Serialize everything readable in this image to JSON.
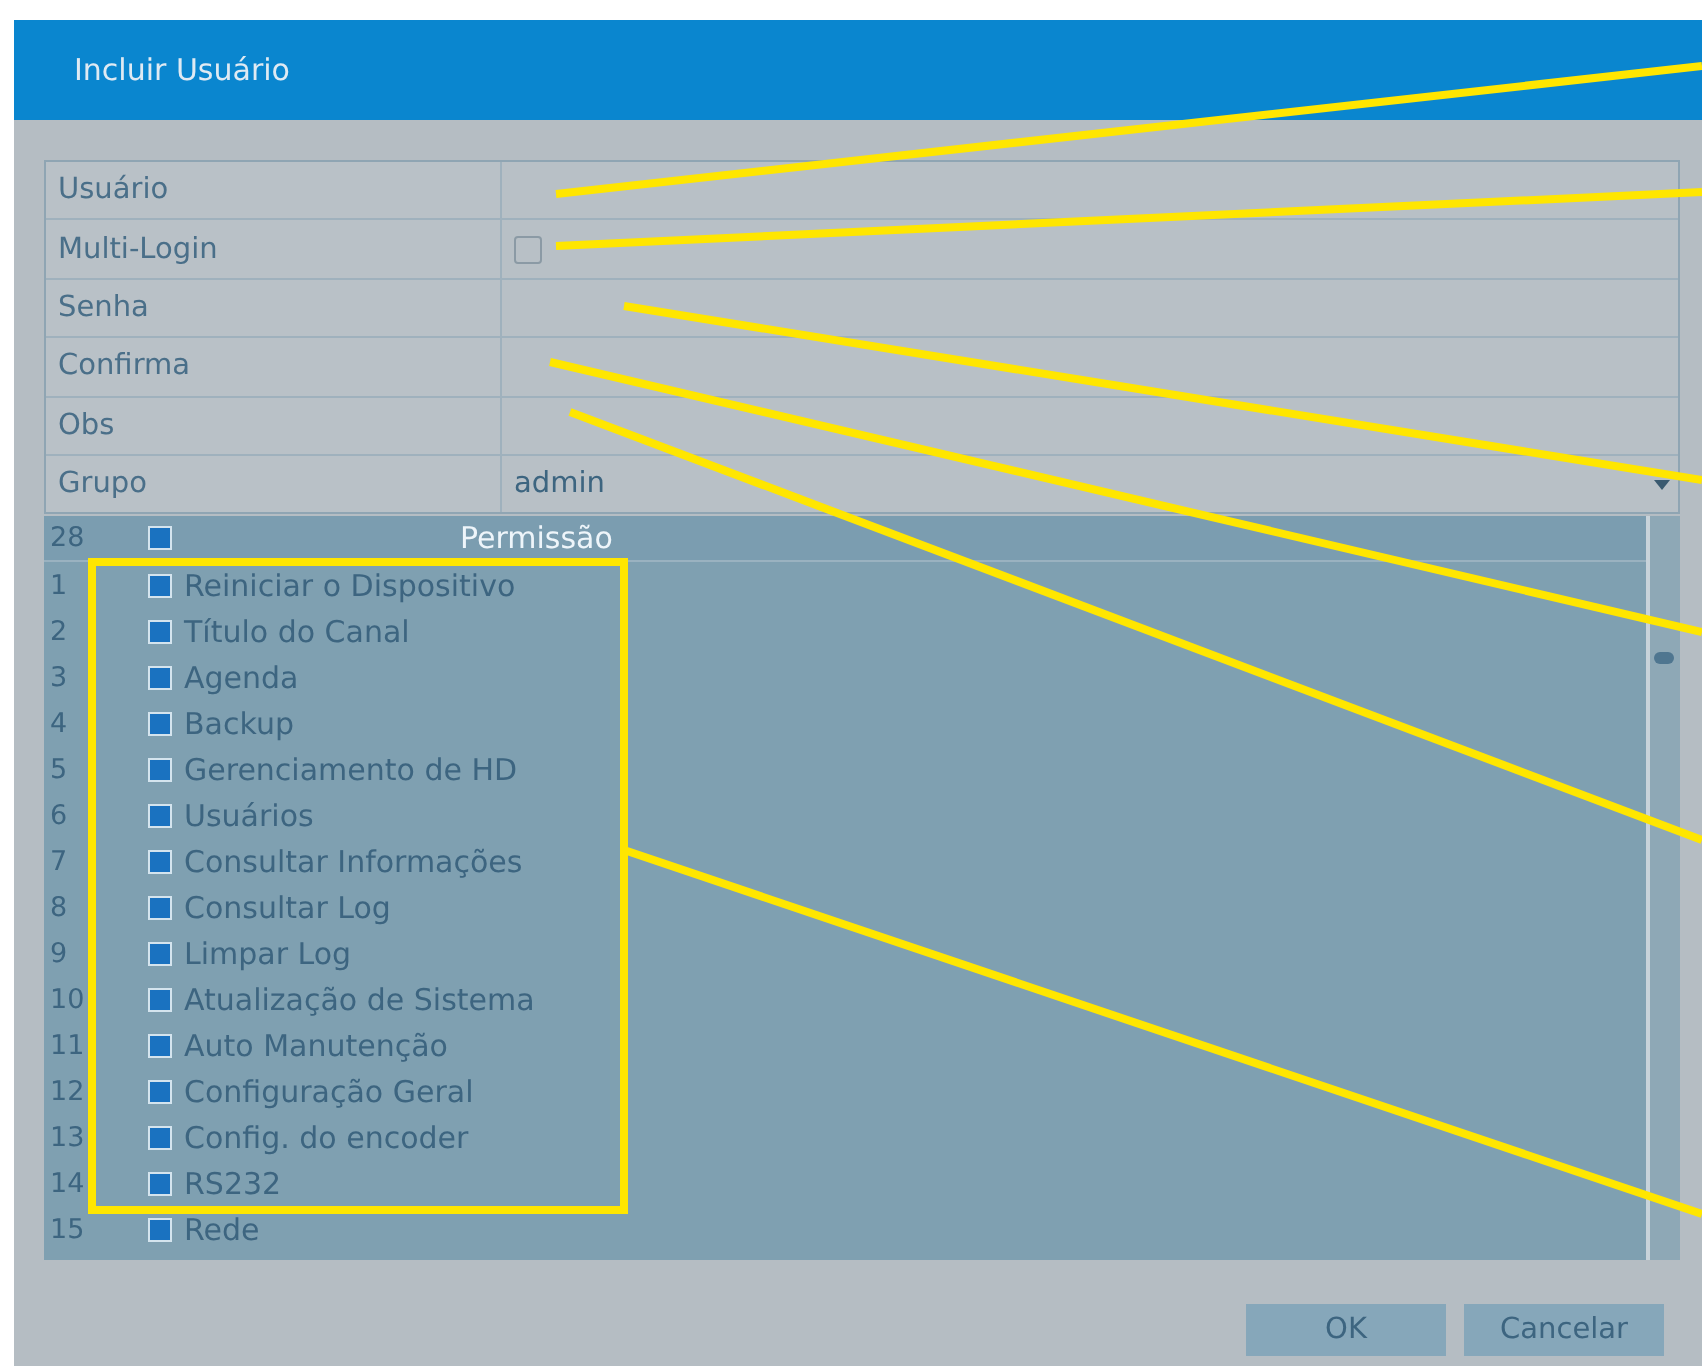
{
  "dialog": {
    "title": "Incluir Usuário"
  },
  "form": [
    {
      "kind": "text",
      "label": "Usuário"
    },
    {
      "kind": "checkbox",
      "label": "Multi-Login",
      "checked": false
    },
    {
      "kind": "text",
      "label": "Senha"
    },
    {
      "kind": "text",
      "label": "Confirma"
    },
    {
      "kind": "text",
      "label": "Obs"
    },
    {
      "kind": "select",
      "label": "Grupo",
      "value": "admin"
    }
  ],
  "permissions": {
    "header": {
      "count": "28",
      "checked": true,
      "title": "Permissão"
    },
    "rows": [
      {
        "number": "1",
        "label": "Reiniciar o Dispositivo",
        "checked": true
      },
      {
        "number": "2",
        "label": "Título do Canal",
        "checked": true
      },
      {
        "number": "3",
        "label": "Agenda",
        "checked": true
      },
      {
        "number": "4",
        "label": "Backup",
        "checked": true
      },
      {
        "number": "5",
        "label": "Gerenciamento de HD",
        "checked": true
      },
      {
        "number": "6",
        "label": "Usuários",
        "checked": true
      },
      {
        "number": "7",
        "label": "Consultar Informações",
        "checked": true
      },
      {
        "number": "8",
        "label": "Consultar Log",
        "checked": true
      },
      {
        "number": "9",
        "label": "Limpar Log",
        "checked": true
      },
      {
        "number": "10",
        "label": "Atualização de Sistema",
        "checked": true
      },
      {
        "number": "11",
        "label": "Auto Manutenção",
        "checked": true
      },
      {
        "number": "12",
        "label": "Configuração Geral",
        "checked": true
      },
      {
        "number": "13",
        "label": "Config. do encoder",
        "checked": true
      },
      {
        "number": "14",
        "label": "RS232",
        "checked": true
      },
      {
        "number": "15",
        "label": "Rede",
        "checked": true
      }
    ]
  },
  "buttons": [
    "OK",
    "Cancelar"
  ]
}
